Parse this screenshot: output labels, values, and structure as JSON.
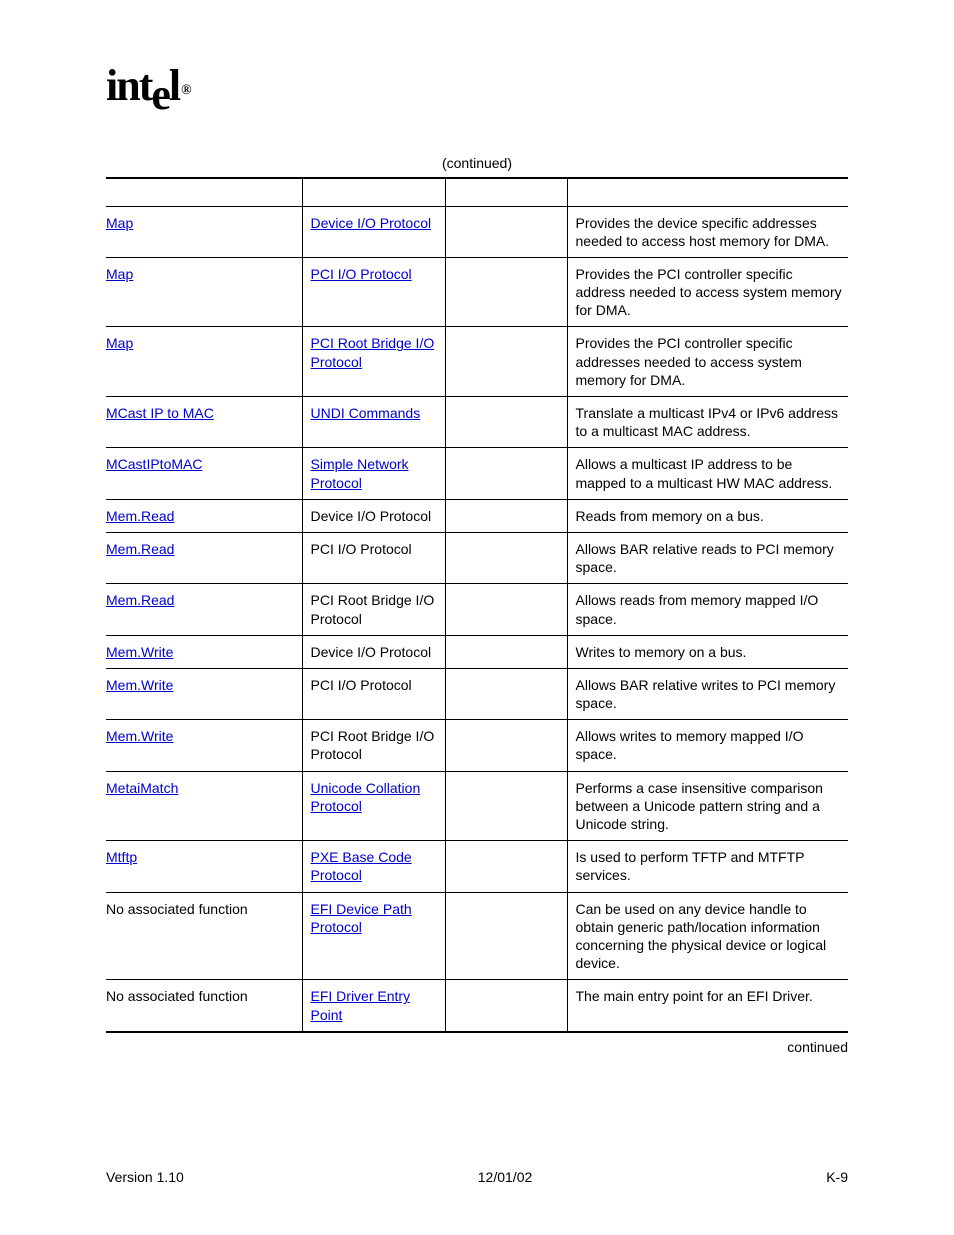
{
  "logo_text": "intel",
  "caption": "(continued)",
  "continued_bottom": "continued",
  "footer": {
    "left": "Version 1.10",
    "center": "12/01/02",
    "right": "K-9"
  },
  "rows": [
    {
      "c1": "Map",
      "c1_link": true,
      "c2": "Device I/O Protocol",
      "c2_link": true,
      "c3": "",
      "c4": "Provides the device specific addresses needed to access host memory for DMA."
    },
    {
      "c1": "Map",
      "c1_link": true,
      "c2": "PCI I/O Protocol",
      "c2_link": true,
      "c3": "",
      "c4": "Provides the PCI controller specific address needed to access system memory for DMA."
    },
    {
      "c1": "Map",
      "c1_link": true,
      "c2": "PCI Root Bridge I/O Protocol",
      "c2_link": true,
      "c3": "",
      "c4": "Provides the PCI controller specific addresses needed to access system memory for DMA."
    },
    {
      "c1": "MCast IP to MAC",
      "c1_link": true,
      "c2": "UNDI Commands",
      "c2_link": true,
      "c3": "",
      "c4": "Translate a multicast IPv4 or IPv6 address to a multicast MAC address."
    },
    {
      "c1": "MCastIPtoMAC",
      "c1_link": true,
      "c2": "Simple Network Protocol",
      "c2_link": true,
      "c3": "",
      "c4": "Allows a multicast IP address to be mapped to a multicast HW MAC address."
    },
    {
      "c1": "Mem.Read",
      "c1_link": true,
      "c2": "Device I/O Protocol",
      "c2_link": false,
      "c3": "",
      "c4": "Reads from memory on a bus."
    },
    {
      "c1": "Mem.Read",
      "c1_link": true,
      "c2": "PCI I/O Protocol",
      "c2_link": false,
      "c3": "",
      "c4": "Allows BAR relative reads to PCI memory space."
    },
    {
      "c1": "Mem.Read",
      "c1_link": true,
      "c2": "PCI Root Bridge I/O Protocol",
      "c2_link": false,
      "c3": "",
      "c4": "Allows reads from memory mapped I/O space."
    },
    {
      "c1": "Mem.Write",
      "c1_link": true,
      "c2": "Device I/O Protocol",
      "c2_link": false,
      "c3": "",
      "c4": "Writes to memory on a bus."
    },
    {
      "c1": "Mem.Write",
      "c1_link": true,
      "c2": "PCI I/O Protocol",
      "c2_link": false,
      "c3": "",
      "c4": "Allows BAR relative writes to PCI memory space."
    },
    {
      "c1": "Mem.Write",
      "c1_link": true,
      "c2": "PCI Root Bridge I/O Protocol",
      "c2_link": false,
      "c3": "",
      "c4": "Allows writes to memory mapped I/O space."
    },
    {
      "c1": "MetaiMatch",
      "c1_link": true,
      "c2": "Unicode Collation Protocol",
      "c2_link": true,
      "c3": "",
      "c4": "Performs a case insensitive comparison between a Unicode pattern string and a Unicode string."
    },
    {
      "c1": "Mtftp",
      "c1_link": true,
      "c2": "PXE Base Code Protocol",
      "c2_link": true,
      "c3": "",
      "c4": "Is used to perform TFTP and MTFTP services."
    },
    {
      "c1": "No associated function",
      "c1_link": false,
      "c2": "EFI Device Path Protocol",
      "c2_link": true,
      "c3": "",
      "c4": "Can be used on any device handle to obtain generic path/location information concerning the physical device or logical device."
    },
    {
      "c1": "No associated function",
      "c1_link": false,
      "c2": "EFI Driver Entry Point",
      "c2_link": true,
      "c3": "",
      "c4": "The main entry point for an EFI Driver."
    }
  ]
}
